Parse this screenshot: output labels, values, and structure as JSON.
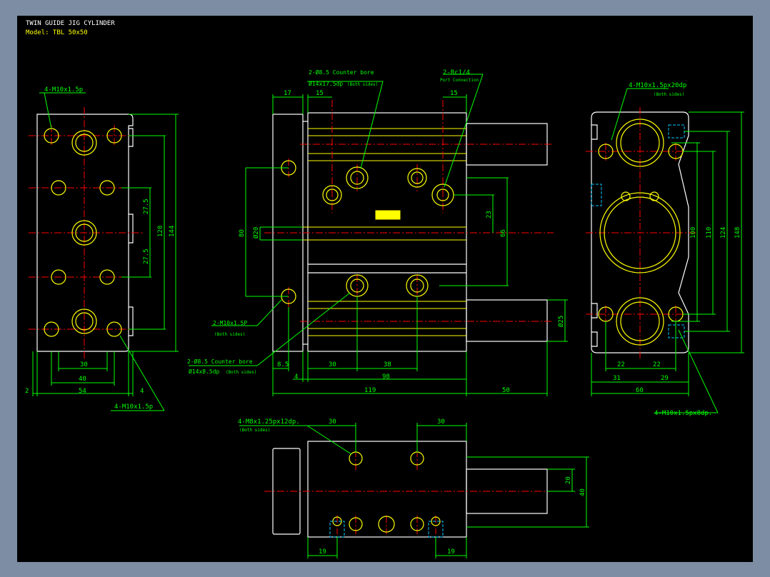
{
  "title": {
    "line1": "TWIN GUIDE JIG CYLINDER",
    "line2": "Model: TBL 50x50"
  },
  "colors": {
    "background": "#000000",
    "outline": "#ffffff",
    "dimension": "#00ff00",
    "center": "#ff0000",
    "feature": "#ffff00",
    "hidden": "#00c8ff",
    "frame": "#7d8da3"
  },
  "callouts": {
    "left_top": "4-M10x1.5p",
    "left_bottom": "4-M10x1.5p",
    "front_cb1_a": "2-Ø8.5 Counter bore",
    "front_cb1_b": "Ø14x17.5dp",
    "front_cb1_c": "(Both sides)",
    "front_port_a": "2-Rc1/4",
    "front_port_b": "Port Connection",
    "front_m10_a": "2-M10x1.5P",
    "front_m10_b": "(Both sides)",
    "front_cb2_a": "2-Ø8.5 Counter bore",
    "front_cb2_b": "Ø14x8.5dp",
    "front_cb2_c": "(Both sides)",
    "right_top_a": "4-M10x1.5px20dp",
    "right_top_b": "(Both sides)",
    "right_bottom": "4-M10x1.5px8dp.",
    "bottom_m8_a": "4-M8x1.25px12dp.",
    "bottom_m8_b": "(Both sides)"
  },
  "dims": {
    "left": {
      "d27a": "27.5",
      "d27b": "27.5",
      "d120": "120",
      "d144": "144",
      "d30": "30",
      "d40": "40",
      "d2": "2",
      "d54": "54",
      "d4": "4"
    },
    "front": {
      "d17": "17",
      "d15a": "15",
      "d15b": "15",
      "d80": "80",
      "d20": "Ø20",
      "d23": "23",
      "d66": "66",
      "d25": "Ø25",
      "d85": "8.5",
      "d30": "30",
      "d38": "38",
      "d4": "4",
      "d98": "98",
      "d119": "119",
      "d50": "50"
    },
    "right": {
      "d100": "100",
      "d110": "110",
      "d124": "124",
      "d148": "148",
      "d22a": "22",
      "d22b": "22",
      "d31": "31",
      "d29": "29",
      "d60": "60"
    },
    "bottom": {
      "d30a": "30",
      "d30b": "30",
      "d20": "20",
      "d40": "40",
      "d19a": "19",
      "d19b": "19"
    }
  }
}
